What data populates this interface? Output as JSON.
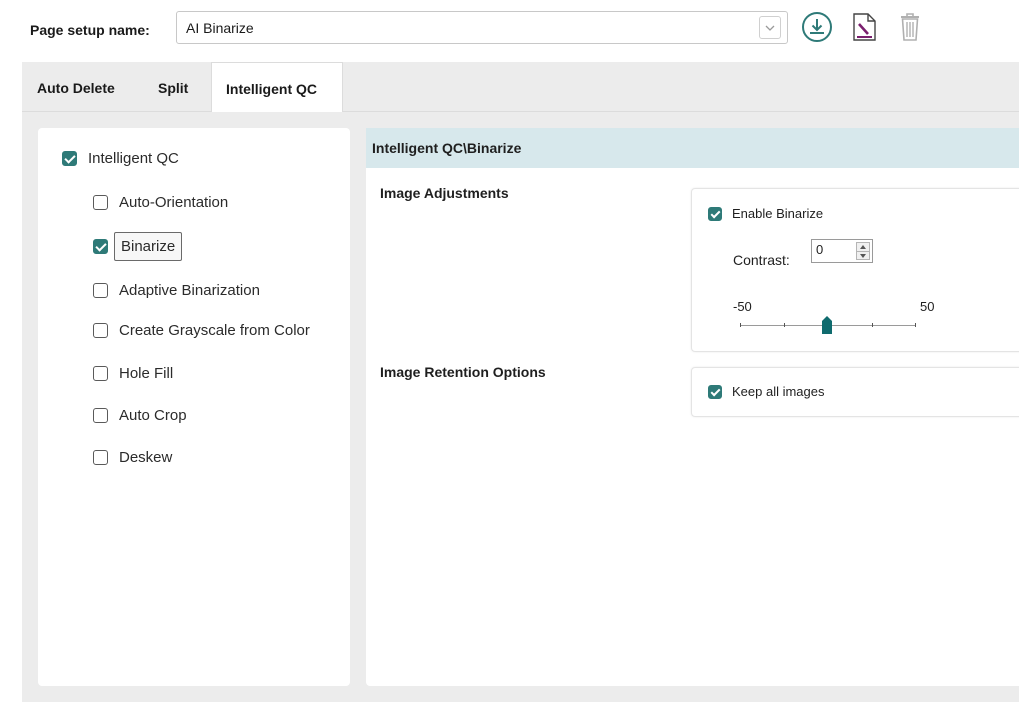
{
  "page_setup": {
    "label": "Page setup name:",
    "value": "AI Binarize"
  },
  "toolbar_icons": [
    "download-icon",
    "edit-document-icon",
    "trash-icon"
  ],
  "tabs": [
    {
      "label": "Auto Delete",
      "active": false
    },
    {
      "label": "Split",
      "active": false
    },
    {
      "label": "Intelligent QC",
      "active": true
    }
  ],
  "tree": {
    "root": {
      "label": "Intelligent QC",
      "checked": true
    },
    "children": [
      {
        "label": "Auto-Orientation",
        "checked": false
      },
      {
        "label": "Binarize",
        "checked": true,
        "selected": true
      },
      {
        "label": "Adaptive Binarization",
        "checked": false
      },
      {
        "label": "Create Grayscale from Color",
        "checked": false
      },
      {
        "label": "Hole Fill",
        "checked": false
      },
      {
        "label": "Auto Crop",
        "checked": false
      },
      {
        "label": "Deskew",
        "checked": false
      }
    ]
  },
  "detail": {
    "path": "Intelligent QC\\Binarize",
    "image_adjustments": {
      "title": "Image Adjustments",
      "enable_label": "Enable Binarize",
      "enable_checked": true,
      "contrast_label": "Contrast:",
      "contrast_value": "0",
      "slider_min": "-50",
      "slider_max": "50",
      "slider_value": 0
    },
    "retention": {
      "title": "Image Retention Options",
      "keep_label": "Keep all images",
      "keep_checked": true
    }
  },
  "colors": {
    "accent": "#2e7a78",
    "path_bar": "#d7e8ec",
    "panel_bg": "#ececec"
  }
}
